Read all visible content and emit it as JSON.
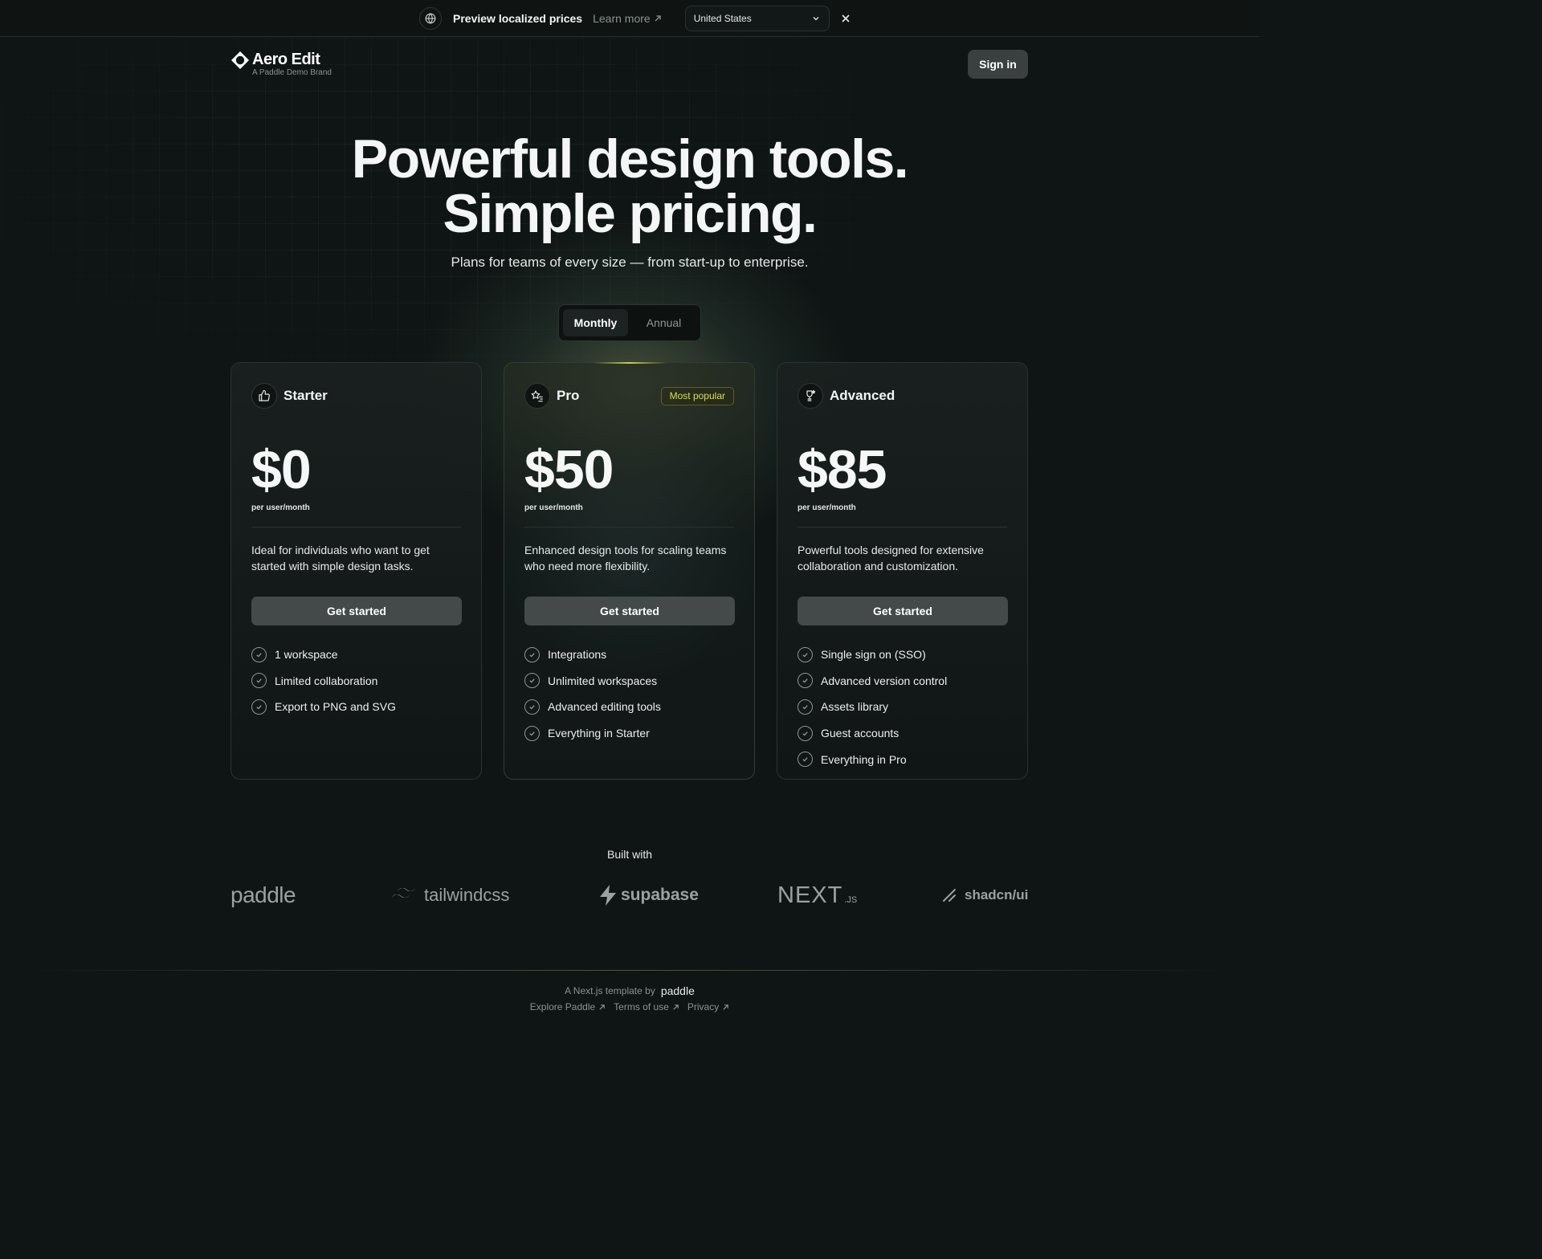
{
  "banner": {
    "title": "Preview localized prices",
    "learn_more": "Learn more",
    "country": "United States"
  },
  "header": {
    "brand_name": "Aero Edit",
    "brand_sub": "A Paddle Demo Brand",
    "sign_in": "Sign in"
  },
  "hero": {
    "title_line1": "Powerful design tools.",
    "title_line2": "Simple pricing.",
    "subtitle": "Plans for teams of every size — from start-up to enterprise."
  },
  "billing_toggle": {
    "options": [
      "Monthly",
      "Annual"
    ],
    "selected": "Monthly"
  },
  "plans": [
    {
      "name": "Starter",
      "icon": "thumbs-up-icon",
      "price": "$0",
      "period": "per user/month",
      "description": "Ideal for individuals who want to get started with simple design tasks.",
      "cta": "Get started",
      "features": [
        "1 workspace",
        "Limited collaboration",
        "Export to PNG and SVG"
      ]
    },
    {
      "name": "Pro",
      "icon": "star-list-icon",
      "badge": "Most popular",
      "price": "$50",
      "period": "per user/month",
      "description": "Enhanced design tools for scaling teams who need more flexibility.",
      "cta": "Get started",
      "features": [
        "Integrations",
        "Unlimited workspaces",
        "Advanced editing tools",
        "Everything in Starter"
      ]
    },
    {
      "name": "Advanced",
      "icon": "trophy-icon",
      "price": "$85",
      "period": "per user/month",
      "description": "Powerful tools designed for extensive collaboration and customization.",
      "cta": "Get started",
      "features": [
        "Single sign on (SSO)",
        "Advanced version control",
        "Assets library",
        "Guest accounts",
        "Everything in Pro"
      ]
    }
  ],
  "built_with": {
    "label": "Built with",
    "brands": [
      "paddle",
      "tailwindcss",
      "supabase",
      "NEXT",
      ".JS",
      "shadcn/ui"
    ]
  },
  "footer": {
    "template_by": "A Next.js template by",
    "template_brand": "paddle",
    "links": [
      "Explore Paddle",
      "Terms of use",
      "Privacy"
    ]
  },
  "colors": {
    "background": "#0f1514",
    "accent": "#d9df4e",
    "button": "#444a4a"
  }
}
